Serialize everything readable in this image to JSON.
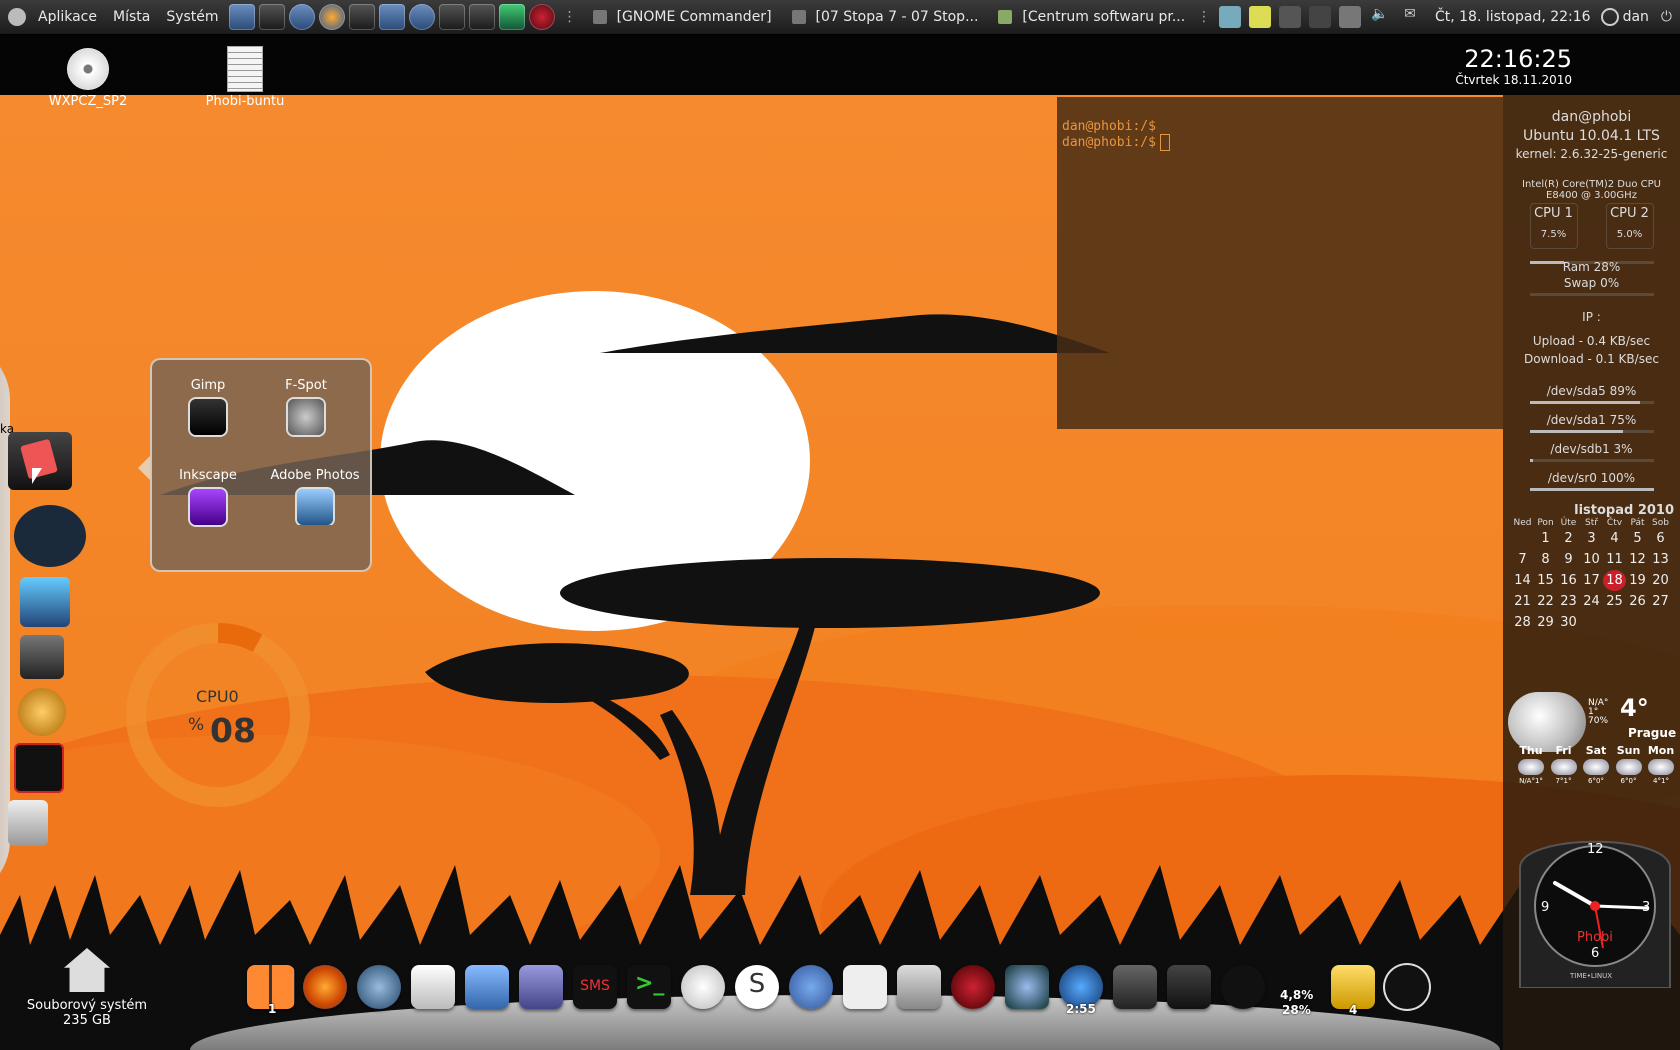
{
  "top_panel": {
    "menus": [
      "Aplikace",
      "Místa",
      "Systém"
    ],
    "tasks": [
      "[GNOME Commander]",
      "[07 Stopa 7 - 07 Stop...",
      "[Centrum softwaru pr..."
    ],
    "datetime": "Čt, 18. listopad, 22:16",
    "user": "dan"
  },
  "desktop_icons": {
    "cd_label": "WXPCZ_SP2",
    "doc_label": "Phobi-buntu",
    "home_label": "Souborový systém",
    "home_size": "235 GB"
  },
  "big_clock": {
    "time": "22:16:25",
    "date": "Čtvrtek 18.11.2010"
  },
  "terminal": {
    "lines": [
      "dan@phobi:/$",
      "dan@phobi:/$"
    ]
  },
  "conky": {
    "user": "dan@phobi",
    "os": "Ubuntu 10.04.1 LTS",
    "kernel": "kernel: 2.6.32-25-generic",
    "cpu_model": "Intel(R) Core(TM)2 Duo CPU",
    "cpu_model2": "E8400  @ 3.00GHz",
    "cpu1_label": "CPU 1",
    "cpu1_value": "7.5%",
    "cpu2_label": "CPU 2",
    "cpu2_value": "5.0%",
    "ram": "Ram 28%",
    "ram_pct": 28,
    "swap": "Swap 0%",
    "swap_pct": 0,
    "ip": "IP :",
    "upload": "Upload - 0.4 KB/sec",
    "download": "Download - 0.1 KB/sec",
    "disks": [
      {
        "label": "/dev/sda5 89%",
        "pct": 89
      },
      {
        "label": "/dev/sda1 75%",
        "pct": 75
      },
      {
        "label": "/dev/sdb1 3%",
        "pct": 3
      },
      {
        "label": "/dev/sr0 100%",
        "pct": 100
      }
    ]
  },
  "calendar": {
    "title": "listopad 2010",
    "days": [
      "Ned",
      "Pon",
      "Úte",
      "Stř",
      "Čtv",
      "Pát",
      "Sob"
    ],
    "weeks": [
      [
        "",
        "1",
        "2",
        "3",
        "4",
        "5",
        "6"
      ],
      [
        "7",
        "8",
        "9",
        "10",
        "11",
        "12",
        "13"
      ],
      [
        "14",
        "15",
        "16",
        "17",
        "18",
        "19",
        "20"
      ],
      [
        "21",
        "22",
        "23",
        "24",
        "25",
        "26",
        "27"
      ],
      [
        "28",
        "29",
        "30",
        "",
        "",
        "",
        ""
      ]
    ],
    "today": "18"
  },
  "weather": {
    "temp": "4°",
    "city": "Prague",
    "na": "N/A°",
    "one": "1°",
    "humidity": "70%",
    "forecast": [
      {
        "day": "Thu",
        "temps": "N/A°1°"
      },
      {
        "day": "Fri",
        "temps": "7°1°"
      },
      {
        "day": "Sat",
        "temps": "6°0°"
      },
      {
        "day": "Sun",
        "temps": "6°0°"
      },
      {
        "day": "Mon",
        "temps": "4°1°"
      }
    ]
  },
  "analog_clock": {
    "n12": "12",
    "n3": "3",
    "n6": "6",
    "n9": "9",
    "name": "Phobi",
    "brand": "TIME•LINUX"
  },
  "stack_popup": {
    "apps": [
      "Gimp",
      "F-Spot",
      "Inkscape",
      "Adobe Photos"
    ]
  },
  "left_dock": {
    "partial_label": "ka"
  },
  "cpu_widget": {
    "label": "CPU0",
    "percent_sign": "%",
    "value": "08",
    "fraction": 0.08
  },
  "dock": {
    "workspace_num": "1",
    "sms_label": "SMS",
    "time_label": "2:55",
    "cpu_pct": "4,8%",
    "mem_pct": "28%",
    "notes_count": "4"
  },
  "colors": {
    "accent": "#f08a2c",
    "today": "#c8202a",
    "terminal_text": "#e69540"
  }
}
